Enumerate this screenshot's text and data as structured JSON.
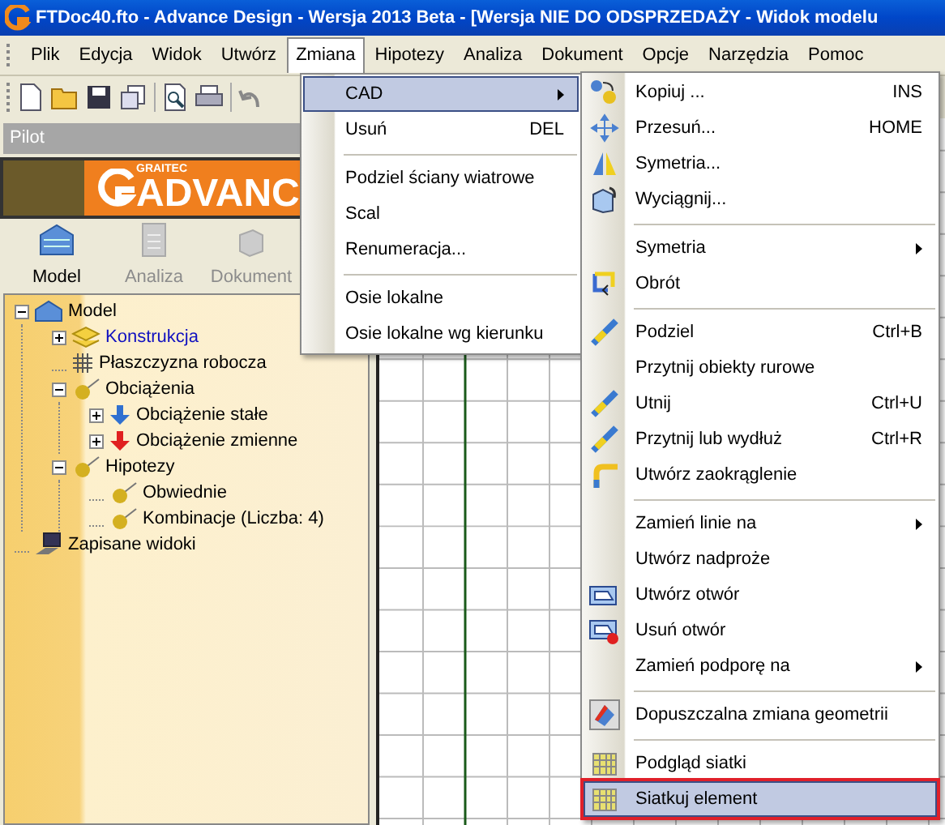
{
  "window": {
    "title": "FTDoc40.fto - Advance Design - Wersja 2013 Beta - [Wersja NIE DO ODSPRZEDAŻY - Widok modelu"
  },
  "menubar": [
    {
      "label": "Plik",
      "selected": false
    },
    {
      "label": "Edycja",
      "selected": false
    },
    {
      "label": "Widok",
      "selected": false
    },
    {
      "label": "Utwórz",
      "selected": false
    },
    {
      "label": "Zmiana",
      "selected": true
    },
    {
      "label": "Hipotezy",
      "selected": false
    },
    {
      "label": "Analiza",
      "selected": false
    },
    {
      "label": "Dokument",
      "selected": false
    },
    {
      "label": "Opcje",
      "selected": false
    },
    {
      "label": "Narzędzia",
      "selected": false
    },
    {
      "label": "Pomoc",
      "selected": false
    }
  ],
  "pilot": {
    "label": "Pilot"
  },
  "banner": {
    "brand": "GRAITEC",
    "product": "ADVANC"
  },
  "tabs": [
    {
      "label": "Model",
      "selected": true
    },
    {
      "label": "Analiza",
      "selected": false
    },
    {
      "label": "Dokument",
      "selected": false
    }
  ],
  "tree": [
    {
      "label": "Model",
      "expanded": true,
      "selected": false,
      "children": [
        {
          "label": "Konstrukcja",
          "expanded": false,
          "selected": true
        },
        {
          "label": "Płaszczyzna robocza",
          "selected": false
        },
        {
          "label": "Obciążenia",
          "expanded": true,
          "selected": false,
          "children": [
            {
              "label": "Obciążenie stałe",
              "expanded": false,
              "selected": false
            },
            {
              "label": "Obciążenie zmienne",
              "expanded": false,
              "selected": false
            }
          ]
        },
        {
          "label": "Hipotezy",
          "expanded": true,
          "selected": false,
          "children": [
            {
              "label": "Obwiednie",
              "selected": false
            },
            {
              "label": "Kombinacje (Liczba: 4)",
              "selected": false
            }
          ]
        }
      ]
    },
    {
      "label": "Zapisane widoki",
      "selected": false
    }
  ],
  "zmiana_menu": {
    "items": [
      {
        "kind": "item",
        "label": "CAD",
        "submenu": true,
        "selected": true
      },
      {
        "kind": "item",
        "label": "Usuń",
        "shortcut": "DEL",
        "selected": false
      },
      {
        "kind": "separator"
      },
      {
        "kind": "item",
        "label": "Podziel ściany wiatrowe",
        "selected": false
      },
      {
        "kind": "item",
        "label": "Scal",
        "selected": false
      },
      {
        "kind": "item",
        "label": "Renumeracja...",
        "selected": false
      },
      {
        "kind": "separator"
      },
      {
        "kind": "item",
        "label": "Osie lokalne",
        "selected": false
      },
      {
        "kind": "item",
        "label": "Osie lokalne wg kierunku",
        "selected": false
      }
    ]
  },
  "cad_menu": {
    "items": [
      {
        "kind": "item",
        "label": "Kopiuj ...",
        "shortcut": "INS",
        "selected": false
      },
      {
        "kind": "item",
        "label": "Przesuń...",
        "shortcut": "HOME",
        "selected": false
      },
      {
        "kind": "item",
        "label": "Symetria...",
        "selected": false
      },
      {
        "kind": "item",
        "label": "Wyciągnij...",
        "selected": false
      },
      {
        "kind": "separator"
      },
      {
        "kind": "item",
        "label": "Symetria",
        "submenu": true,
        "selected": false
      },
      {
        "kind": "item",
        "label": "Obrót",
        "selected": false
      },
      {
        "kind": "separator"
      },
      {
        "kind": "item",
        "label": "Podziel",
        "shortcut": "Ctrl+B",
        "selected": false
      },
      {
        "kind": "item",
        "label": "Przytnij obiekty rurowe",
        "selected": false
      },
      {
        "kind": "item",
        "label": "Utnij",
        "shortcut": "Ctrl+U",
        "selected": false
      },
      {
        "kind": "item",
        "label": "Przytnij lub wydłuż",
        "shortcut": "Ctrl+R",
        "selected": false
      },
      {
        "kind": "item",
        "label": "Utwórz zaokrąglenie",
        "selected": false
      },
      {
        "kind": "separator"
      },
      {
        "kind": "item",
        "label": "Zamień linie na",
        "submenu": true,
        "selected": false
      },
      {
        "kind": "item",
        "label": "Utwórz nadproże",
        "selected": false
      },
      {
        "kind": "item",
        "label": "Utwórz otwór",
        "selected": false
      },
      {
        "kind": "item",
        "label": "Usuń otwór",
        "selected": false
      },
      {
        "kind": "item",
        "label": "Zamień podporę na",
        "submenu": true,
        "selected": false
      },
      {
        "kind": "separator"
      },
      {
        "kind": "item",
        "label": "Dopuszczalna zmiana geometrii",
        "selected": false
      },
      {
        "kind": "separator"
      },
      {
        "kind": "item",
        "label": "Podgląd siatki",
        "selected": false
      },
      {
        "kind": "item",
        "label": "Siatkuj element",
        "selected": true,
        "annotated": true
      }
    ]
  }
}
